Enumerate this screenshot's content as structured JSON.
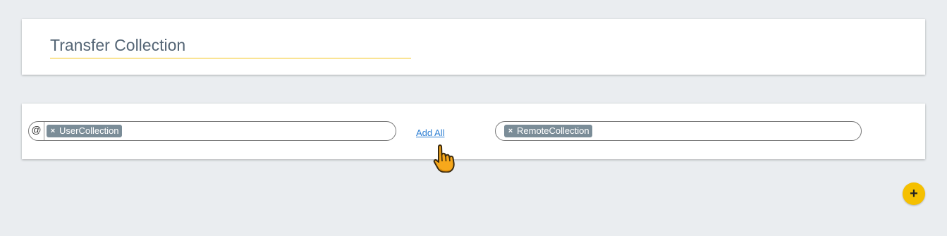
{
  "header": {
    "title": "Transfer Collection"
  },
  "transfer": {
    "source": {
      "prefix": "@",
      "chip_remove_icon": "×",
      "chip_label": "UserCollection"
    },
    "add_all_label": "Add All",
    "target": {
      "chip_remove_icon": "×",
      "chip_label": "RemoteCollection"
    }
  },
  "fab": {
    "icon": "+",
    "color": "#f5c000"
  },
  "colors": {
    "background": "#eaedf0",
    "title_underline": "#f5c518",
    "chip": "#7b8d98",
    "link": "#2e7fd3"
  }
}
